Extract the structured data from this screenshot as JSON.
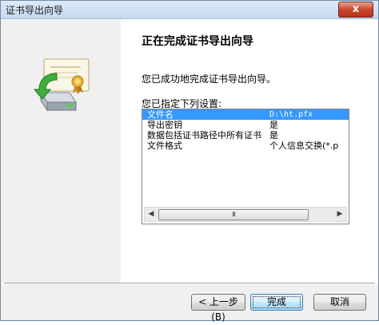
{
  "window": {
    "title": "证书导出向导",
    "close_glyph": "x"
  },
  "icons": {
    "wizard_image": "certificate-export-wizard-icon",
    "close": "close-icon"
  },
  "main": {
    "heading": "正在完成证书导出向导",
    "done_message": "您已成功地完成证书导出向导。",
    "settings_label": "您已指定下列设置:"
  },
  "settings_list": {
    "rows": [
      {
        "name": "文件名",
        "value": "D:\\ht.pfx",
        "selected": true
      },
      {
        "name": "导出密钥",
        "value": "是",
        "selected": false
      },
      {
        "name": "数据包括证书路径中所有证书",
        "value": "是",
        "selected": false
      },
      {
        "name": "文件格式",
        "value": "个人信息交换(*.p",
        "selected": false
      }
    ],
    "scroll_left_glyph": "◀",
    "scroll_right_glyph": "▶",
    "thumb_grip": "III"
  },
  "buttons": {
    "back": "< 上一步(B)",
    "finish": "完成",
    "cancel": "取消"
  },
  "colors": {
    "selection": "#3399ff",
    "close_button": "#c9452d",
    "default_button": "#bee6fd"
  }
}
